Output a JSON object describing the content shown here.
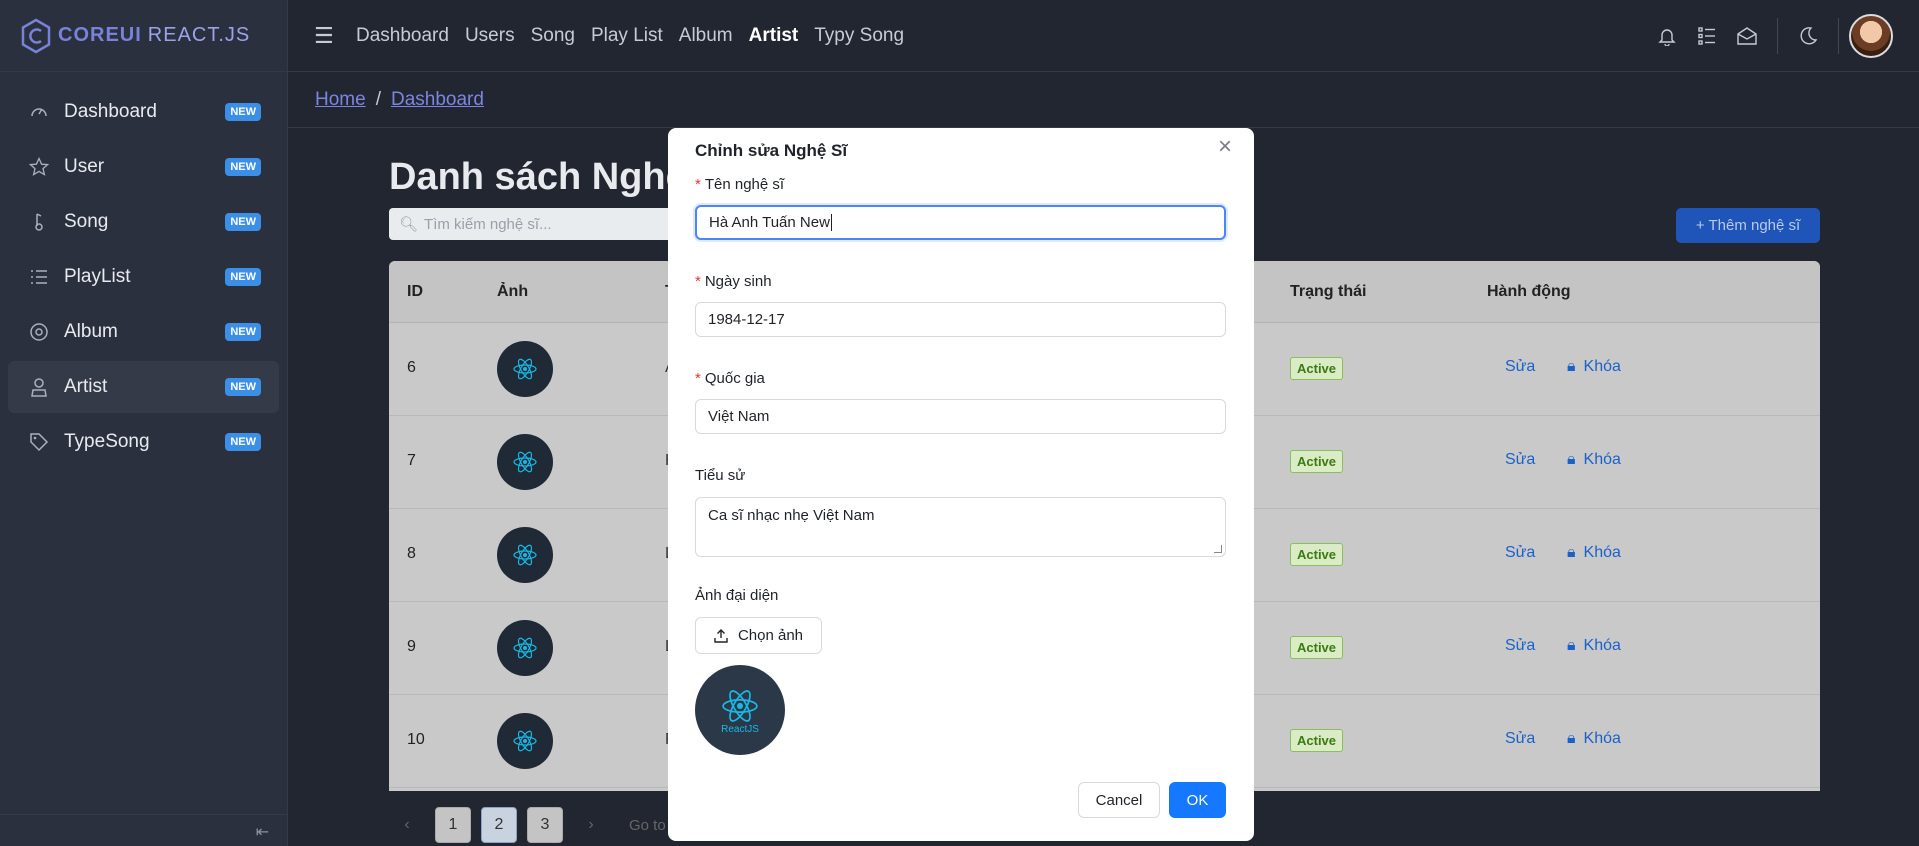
{
  "brand": {
    "name_bold": "COREUI",
    "name_light": "REACT.JS"
  },
  "sidebar": {
    "items": [
      {
        "label": "Dashboard",
        "badge": "NEW",
        "icon": "speedometer-icon"
      },
      {
        "label": "User",
        "badge": "NEW",
        "icon": "star-icon"
      },
      {
        "label": "Song",
        "badge": "NEW",
        "icon": "music-icon"
      },
      {
        "label": "PlayList",
        "badge": "NEW",
        "icon": "list-icon"
      },
      {
        "label": "Album",
        "badge": "NEW",
        "icon": "disc-icon"
      },
      {
        "label": "Artist",
        "badge": "NEW",
        "icon": "person-icon",
        "active": true
      },
      {
        "label": "TypeSong",
        "badge": "NEW",
        "icon": "tag-icon"
      }
    ]
  },
  "header": {
    "nav": [
      "Dashboard",
      "Users",
      "Song",
      "Play List",
      "Album",
      "Artist",
      "Typy Song"
    ],
    "active_nav": "Artist"
  },
  "breadcrumb": {
    "home": "Home",
    "current": "Dashboard"
  },
  "page": {
    "title": "Danh sách Nghệ",
    "search_placeholder": "Tìm kiếm nghệ sĩ...",
    "add_button": "+ Thêm nghệ sĩ"
  },
  "table": {
    "columns": [
      "ID",
      "Ảnh",
      "T",
      "Trạng thái",
      "Hành động"
    ],
    "rows": [
      {
        "id": "6",
        "col3": "A",
        "status": "Active",
        "edit": "Sửa",
        "lock": "Khóa"
      },
      {
        "id": "7",
        "col3": "H",
        "status": "Active",
        "edit": "Sửa",
        "lock": "Khóa"
      },
      {
        "id": "8",
        "col3": "L",
        "status": "Active",
        "edit": "Sửa",
        "lock": "Khóa"
      },
      {
        "id": "9",
        "col3": "L",
        "status": "Active",
        "edit": "Sửa",
        "lock": "Khóa"
      },
      {
        "id": "10",
        "col3": "F",
        "status": "Active",
        "edit": "Sửa",
        "lock": "Khóa"
      }
    ],
    "avatar_text": "ReactJS"
  },
  "pagination": {
    "pages": [
      "1",
      "2",
      "3"
    ],
    "current": "2",
    "goto": "Go to"
  },
  "modal": {
    "title": "Chỉnh sửa Nghệ Sĩ",
    "name_label": "Tên nghệ sĩ",
    "name_value": "Hà Anh Tuấn New",
    "dob_label": "Ngày sinh",
    "dob_value": "1984-12-17",
    "country_label": "Quốc gia",
    "country_value": "Việt Nam",
    "bio_label": "Tiểu sử",
    "bio_value": "Ca sĩ nhạc nhẹ Việt Nam",
    "avatar_label": "Ảnh đại diện",
    "upload_button": "Chọn ảnh",
    "preview_text": "ReactJS",
    "cancel": "Cancel",
    "ok": "OK"
  },
  "colors": {
    "sidebar_bg": "#2a303d",
    "page_bg": "#212631",
    "badge": "#3c8fe6",
    "primary": "#1677ff",
    "link": "#7c85e0"
  }
}
